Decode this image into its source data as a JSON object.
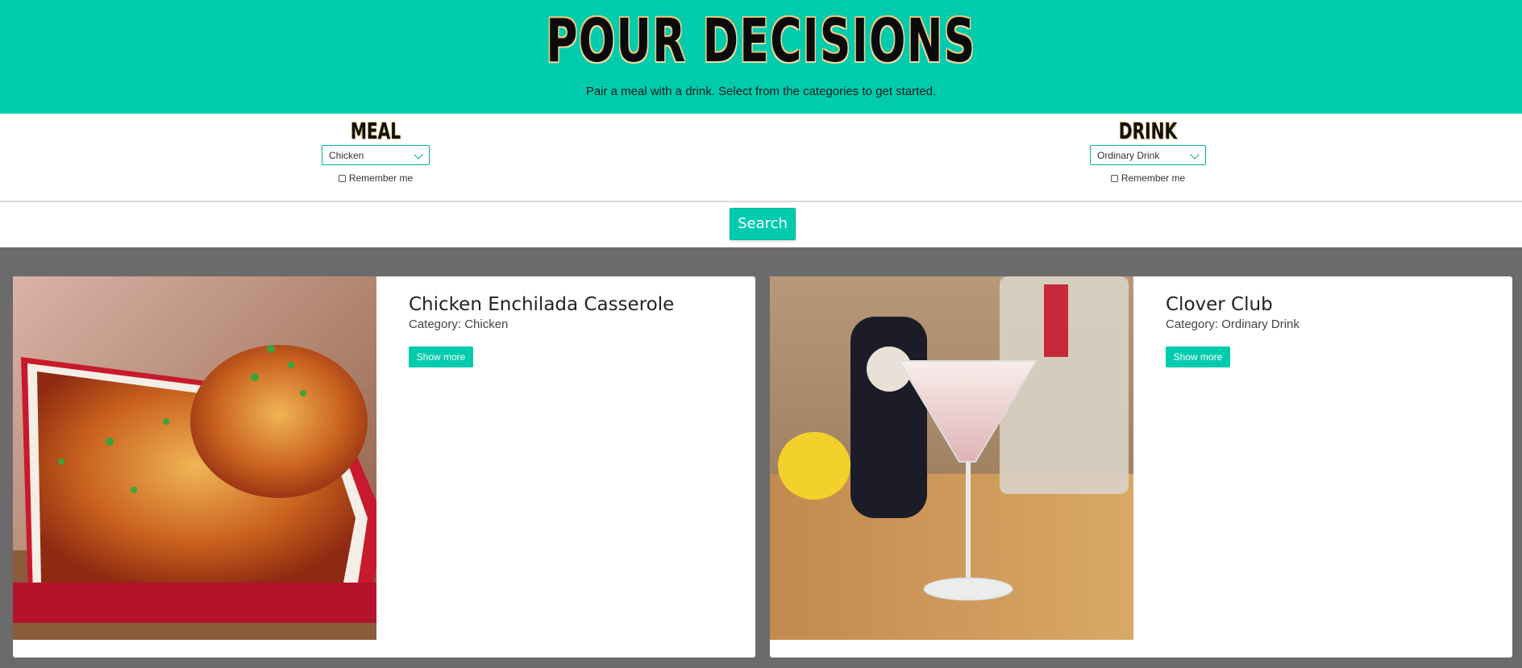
{
  "header": {
    "title": "POUR DECISIONS",
    "subtitle": "Pair a meal with a drink. Select from the categories to get started."
  },
  "meal": {
    "heading": "MEAL",
    "selected": "Chicken",
    "remember_label": "Remember me"
  },
  "drink": {
    "heading": "DRINK",
    "selected": "Ordinary Drink",
    "remember_label": "Remember me"
  },
  "search": {
    "label": "Search"
  },
  "cards": [
    {
      "title": "Chicken Enchilada Casserole",
      "category": "Category: Chicken",
      "button": "Show more"
    },
    {
      "title": "Clover Club",
      "category": "Category: Ordinary Drink",
      "button": "Show more"
    }
  ],
  "colors": {
    "accent": "#00ccad",
    "background": "#6b6b6b"
  }
}
